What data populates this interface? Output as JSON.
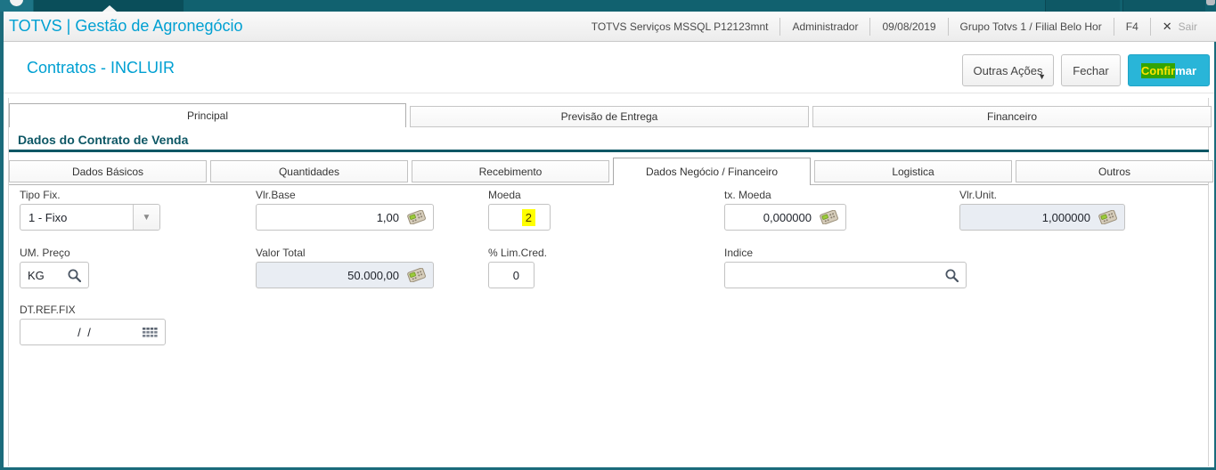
{
  "colors": {
    "topbar_teal": "#11616f",
    "accent_cyan": "#00a0d2",
    "section_teal": "#0d5765",
    "confirm_button": "#29b5d8",
    "annotation_yellow": "#ffff00",
    "annotation_green": "#33a405",
    "disabled_field_bg": "#e9edf3"
  },
  "icons": {
    "exit": "✕",
    "combo_arrow": "▼",
    "menu_arrow": "▼",
    "search": "magnifier-glyph",
    "calculator": "calculator-glyph",
    "calendar": "calendar-grid-glyph",
    "tab_pointer": "triangle-up"
  },
  "header": {
    "app_title": "TOTVS | Gestão de Agronegócio",
    "server": "TOTVS Serviços MSSQL P12123mnt",
    "user": "Administrador",
    "date": "09/08/2019",
    "branch": "Grupo Totvs 1 / Filial Belo Hor",
    "fkey": "F4",
    "exit_label": "Sair"
  },
  "toolbar": {
    "page_title": "Contratos - INCLUIR",
    "other_actions": "Outras Ações",
    "close": "Fechar",
    "confirm_highlighted_part": "Confir",
    "confirm_rest_part": "mar"
  },
  "tabs": {
    "main": [
      {
        "label": "Principal",
        "active": true
      },
      {
        "label": "Previsão de Entrega",
        "active": false
      },
      {
        "label": "Financeiro",
        "active": false
      }
    ],
    "section_title": "Dados do Contrato de Venda",
    "sub": [
      {
        "label": "Dados Básicos",
        "active": false
      },
      {
        "label": "Quantidades",
        "active": false
      },
      {
        "label": "Recebimento",
        "active": false
      },
      {
        "label": "Dados Negócio / Financeiro",
        "active": true
      },
      {
        "label": "Logistica",
        "active": false
      },
      {
        "label": "Outros",
        "active": false
      }
    ]
  },
  "form": {
    "tipo_fix": {
      "label": "Tipo Fix.",
      "value": "1 - Fixo"
    },
    "vlr_base": {
      "label": "Vlr.Base",
      "value": "1,00"
    },
    "moeda": {
      "label": "Moeda",
      "value": "2"
    },
    "tx_moeda": {
      "label": "tx. Moeda",
      "value": "0,000000"
    },
    "vlr_unit": {
      "label": "Vlr.Unit.",
      "value": "1,000000"
    },
    "um_preco": {
      "label": "UM. Preço",
      "value": "KG"
    },
    "valor_total": {
      "label": "Valor Total",
      "value": "50.000,00"
    },
    "lim_cred": {
      "label": "% Lim.Cred.",
      "value": "0"
    },
    "indice": {
      "label": "Indice",
      "value": ""
    },
    "dt_ref_fix": {
      "label": "DT.REF.FIX",
      "value": "/ /"
    }
  }
}
